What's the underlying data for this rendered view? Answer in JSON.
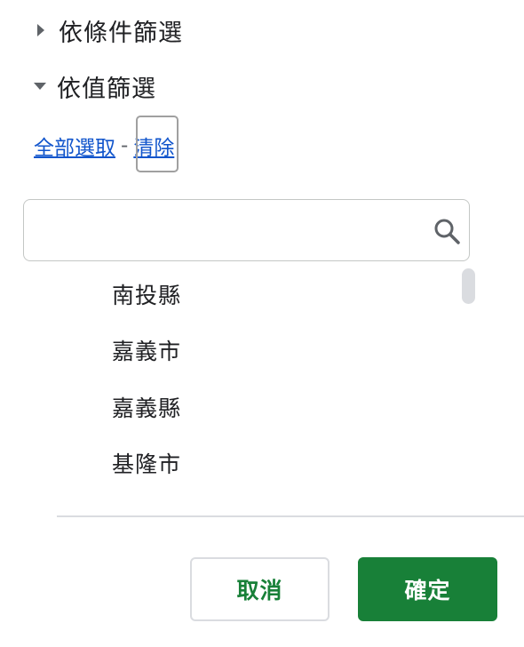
{
  "sections": {
    "by_condition": {
      "label": "依條件篩選",
      "expanded": false
    },
    "by_value": {
      "label": "依值篩選",
      "expanded": true
    }
  },
  "links": {
    "select_all": "全部選取",
    "separator": "-",
    "clear": "清除"
  },
  "search": {
    "value": "",
    "placeholder": "",
    "icon": "search-icon"
  },
  "values": [
    {
      "label": "南投縣"
    },
    {
      "label": "嘉義市"
    },
    {
      "label": "嘉義縣"
    },
    {
      "label": "基隆市"
    }
  ],
  "buttons": {
    "cancel": "取消",
    "ok": "確定"
  },
  "colors": {
    "accent_green": "#188038",
    "link_blue": "#1155cc",
    "text": "#202124",
    "border": "#dadce0"
  }
}
